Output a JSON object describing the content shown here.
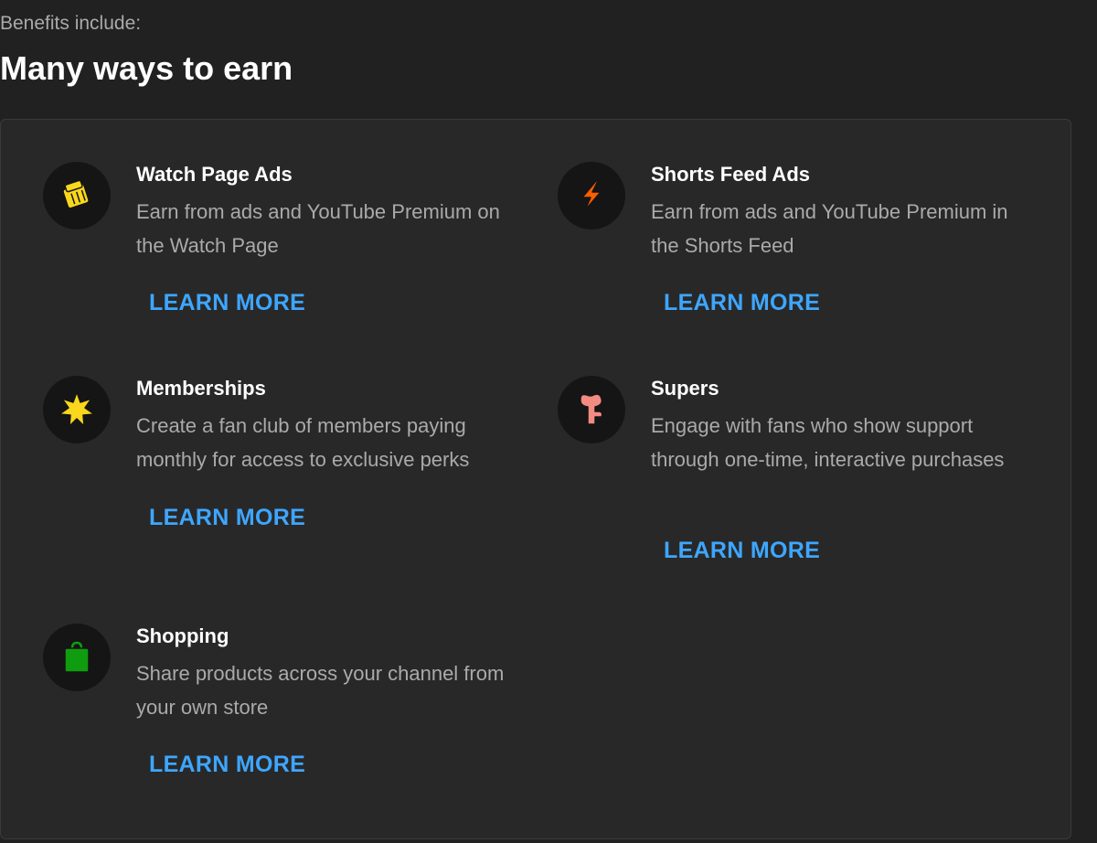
{
  "header": {
    "subtitle": "Benefits include:",
    "title": "Many ways to earn"
  },
  "items": [
    {
      "title": "Watch Page Ads",
      "description": "Earn from ads and YouTube Premium on the Watch Page",
      "link": "LEARN MORE",
      "icon": "ticket-icon",
      "icon_color": "#f9d71c"
    },
    {
      "title": "Shorts Feed Ads",
      "description": "Earn from ads and YouTube Premium in the Shorts Feed",
      "link": "LEARN MORE",
      "icon": "lightning-icon",
      "icon_color": "#ff5e00"
    },
    {
      "title": "Memberships",
      "description": "Create a fan club of members paying monthly for access to exclusive perks",
      "link": "LEARN MORE",
      "icon": "star-badge-icon",
      "icon_color": "#f9d71c"
    },
    {
      "title": "Supers",
      "description": "Engage with fans who show support through one-time, interactive purchases",
      "link": "LEARN MORE",
      "icon": "heart-gift-icon",
      "icon_color": "#f28b82"
    },
    {
      "title": "Shopping",
      "description": "Share products across your channel from your own store",
      "link": "LEARN MORE",
      "icon": "shopping-bag-icon",
      "icon_color": "#0f9d0f"
    }
  ],
  "colors": {
    "background": "#212121",
    "card": "#282828",
    "link": "#3ea6ff"
  }
}
